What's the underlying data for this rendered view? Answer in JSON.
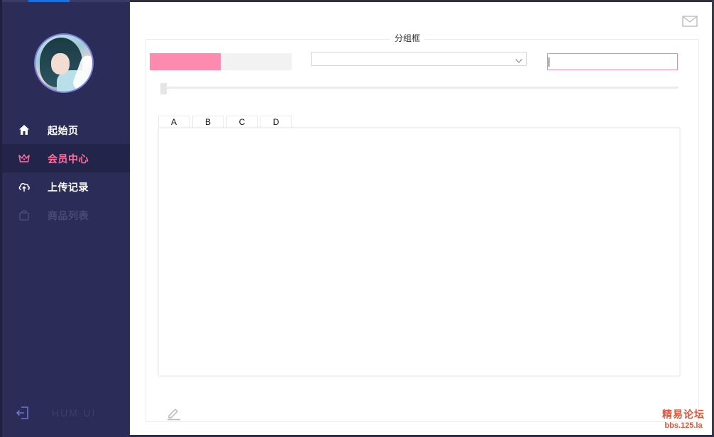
{
  "sidebar": {
    "items": [
      {
        "label": "起始页",
        "icon": "home-icon",
        "state": "normal"
      },
      {
        "label": "会员中心",
        "icon": "crown-icon",
        "state": "active"
      },
      {
        "label": "上传记录",
        "icon": "cloud-upload-icon",
        "state": "normal"
      },
      {
        "label": "商品列表",
        "icon": "shopping-bag-icon",
        "state": "disabled"
      }
    ],
    "brand": "HUM·UI",
    "logout_icon": "logout-icon"
  },
  "main": {
    "groupbox_title": "分组框",
    "progress": {
      "value": 0.5
    },
    "combo": {
      "value": ""
    },
    "text_input": {
      "value": ""
    },
    "slider": {
      "value": 0
    },
    "tabs": [
      {
        "label": "A"
      },
      {
        "label": "B"
      },
      {
        "label": "C"
      },
      {
        "label": "D"
      }
    ],
    "mail_icon": "mail-icon",
    "edit_icon": "edit-icon"
  },
  "watermark": {
    "line1": "精易论坛",
    "line2": "bbs.125.la"
  },
  "colors": {
    "sidebar_bg": "#2b2c57",
    "active_bg": "#23244a",
    "accent_pink": "#ff6fa0",
    "progress_fill": "#ff8aaf",
    "input_border": "#e38bb7",
    "watermark": "#e0553a"
  }
}
